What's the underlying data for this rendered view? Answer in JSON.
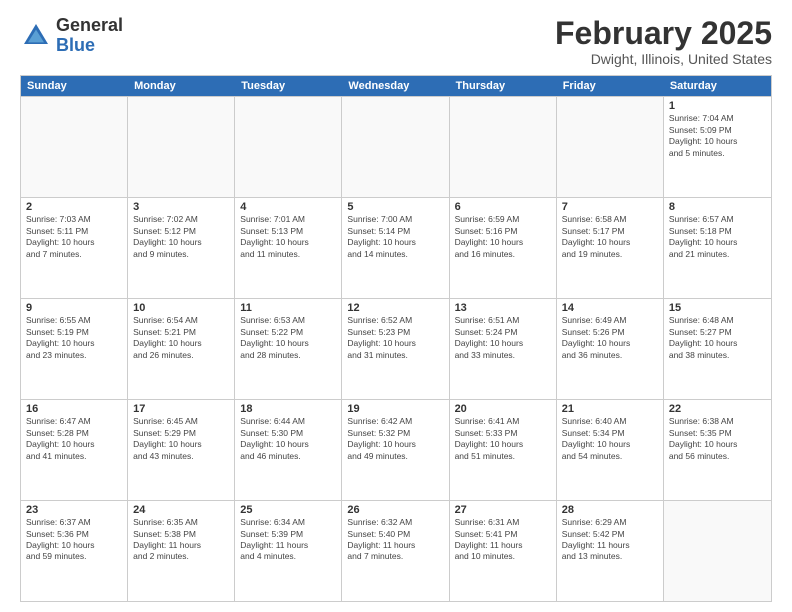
{
  "header": {
    "logo_general": "General",
    "logo_blue": "Blue",
    "title": "February 2025",
    "subtitle": "Dwight, Illinois, United States"
  },
  "columns": [
    "Sunday",
    "Monday",
    "Tuesday",
    "Wednesday",
    "Thursday",
    "Friday",
    "Saturday"
  ],
  "rows": [
    [
      {
        "day": "",
        "info": ""
      },
      {
        "day": "",
        "info": ""
      },
      {
        "day": "",
        "info": ""
      },
      {
        "day": "",
        "info": ""
      },
      {
        "day": "",
        "info": ""
      },
      {
        "day": "",
        "info": ""
      },
      {
        "day": "1",
        "info": "Sunrise: 7:04 AM\nSunset: 5:09 PM\nDaylight: 10 hours\nand 5 minutes."
      }
    ],
    [
      {
        "day": "2",
        "info": "Sunrise: 7:03 AM\nSunset: 5:11 PM\nDaylight: 10 hours\nand 7 minutes."
      },
      {
        "day": "3",
        "info": "Sunrise: 7:02 AM\nSunset: 5:12 PM\nDaylight: 10 hours\nand 9 minutes."
      },
      {
        "day": "4",
        "info": "Sunrise: 7:01 AM\nSunset: 5:13 PM\nDaylight: 10 hours\nand 11 minutes."
      },
      {
        "day": "5",
        "info": "Sunrise: 7:00 AM\nSunset: 5:14 PM\nDaylight: 10 hours\nand 14 minutes."
      },
      {
        "day": "6",
        "info": "Sunrise: 6:59 AM\nSunset: 5:16 PM\nDaylight: 10 hours\nand 16 minutes."
      },
      {
        "day": "7",
        "info": "Sunrise: 6:58 AM\nSunset: 5:17 PM\nDaylight: 10 hours\nand 19 minutes."
      },
      {
        "day": "8",
        "info": "Sunrise: 6:57 AM\nSunset: 5:18 PM\nDaylight: 10 hours\nand 21 minutes."
      }
    ],
    [
      {
        "day": "9",
        "info": "Sunrise: 6:55 AM\nSunset: 5:19 PM\nDaylight: 10 hours\nand 23 minutes."
      },
      {
        "day": "10",
        "info": "Sunrise: 6:54 AM\nSunset: 5:21 PM\nDaylight: 10 hours\nand 26 minutes."
      },
      {
        "day": "11",
        "info": "Sunrise: 6:53 AM\nSunset: 5:22 PM\nDaylight: 10 hours\nand 28 minutes."
      },
      {
        "day": "12",
        "info": "Sunrise: 6:52 AM\nSunset: 5:23 PM\nDaylight: 10 hours\nand 31 minutes."
      },
      {
        "day": "13",
        "info": "Sunrise: 6:51 AM\nSunset: 5:24 PM\nDaylight: 10 hours\nand 33 minutes."
      },
      {
        "day": "14",
        "info": "Sunrise: 6:49 AM\nSunset: 5:26 PM\nDaylight: 10 hours\nand 36 minutes."
      },
      {
        "day": "15",
        "info": "Sunrise: 6:48 AM\nSunset: 5:27 PM\nDaylight: 10 hours\nand 38 minutes."
      }
    ],
    [
      {
        "day": "16",
        "info": "Sunrise: 6:47 AM\nSunset: 5:28 PM\nDaylight: 10 hours\nand 41 minutes."
      },
      {
        "day": "17",
        "info": "Sunrise: 6:45 AM\nSunset: 5:29 PM\nDaylight: 10 hours\nand 43 minutes."
      },
      {
        "day": "18",
        "info": "Sunrise: 6:44 AM\nSunset: 5:30 PM\nDaylight: 10 hours\nand 46 minutes."
      },
      {
        "day": "19",
        "info": "Sunrise: 6:42 AM\nSunset: 5:32 PM\nDaylight: 10 hours\nand 49 minutes."
      },
      {
        "day": "20",
        "info": "Sunrise: 6:41 AM\nSunset: 5:33 PM\nDaylight: 10 hours\nand 51 minutes."
      },
      {
        "day": "21",
        "info": "Sunrise: 6:40 AM\nSunset: 5:34 PM\nDaylight: 10 hours\nand 54 minutes."
      },
      {
        "day": "22",
        "info": "Sunrise: 6:38 AM\nSunset: 5:35 PM\nDaylight: 10 hours\nand 56 minutes."
      }
    ],
    [
      {
        "day": "23",
        "info": "Sunrise: 6:37 AM\nSunset: 5:36 PM\nDaylight: 10 hours\nand 59 minutes."
      },
      {
        "day": "24",
        "info": "Sunrise: 6:35 AM\nSunset: 5:38 PM\nDaylight: 11 hours\nand 2 minutes."
      },
      {
        "day": "25",
        "info": "Sunrise: 6:34 AM\nSunset: 5:39 PM\nDaylight: 11 hours\nand 4 minutes."
      },
      {
        "day": "26",
        "info": "Sunrise: 6:32 AM\nSunset: 5:40 PM\nDaylight: 11 hours\nand 7 minutes."
      },
      {
        "day": "27",
        "info": "Sunrise: 6:31 AM\nSunset: 5:41 PM\nDaylight: 11 hours\nand 10 minutes."
      },
      {
        "day": "28",
        "info": "Sunrise: 6:29 AM\nSunset: 5:42 PM\nDaylight: 11 hours\nand 13 minutes."
      },
      {
        "day": "",
        "info": ""
      }
    ]
  ]
}
